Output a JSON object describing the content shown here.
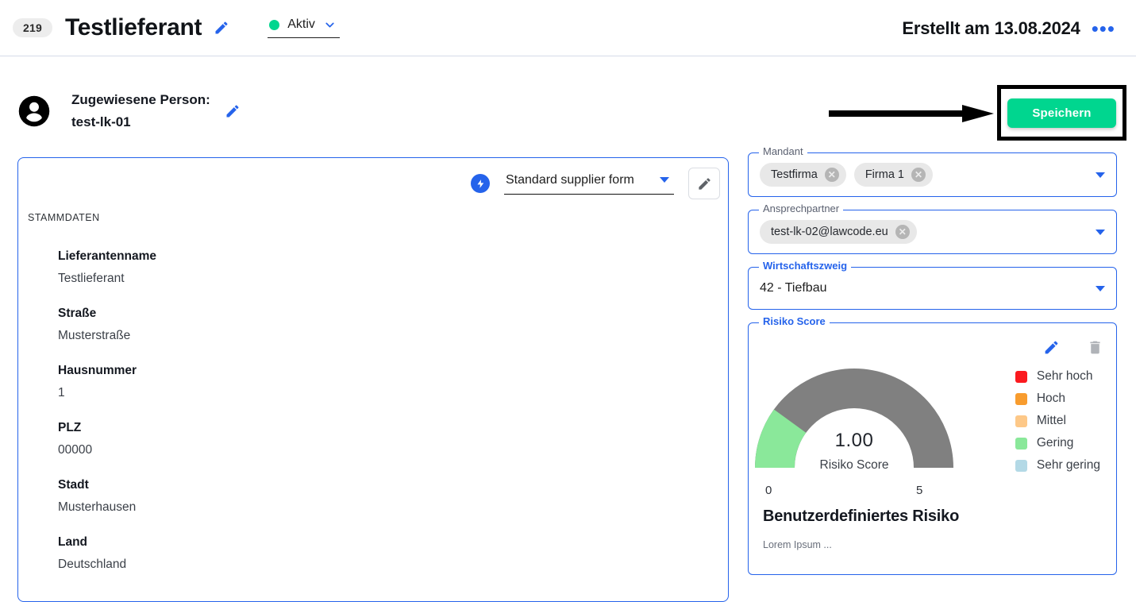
{
  "header": {
    "id_badge": "219",
    "title": "Testlieferant",
    "edit_icon": "pencil-icon",
    "status": {
      "label": "Aktiv",
      "dot_color": "#00d68f",
      "chevron_icon": "chevron-down-icon"
    },
    "created_text": "Erstellt am 13.08.2024",
    "more_menu": "•••"
  },
  "person": {
    "avatar_icon": "account-circle-icon",
    "label": "Zugewiesene Person:",
    "name": "test-lk-01",
    "edit_icon": "pencil-icon"
  },
  "save": {
    "label": "Speichern",
    "color": "#00d68f",
    "annotation_arrow": "arrow-right-annotation",
    "highlight_box": "black-highlight-box"
  },
  "form_card": {
    "bolt_icon": "lightning-bolt-icon",
    "form_select_value": "Standard supplier form",
    "edit_icon": "pencil-icon",
    "section_label": "STAMMDATEN",
    "fields": [
      {
        "label": "Lieferantenname",
        "value": "Testlieferant"
      },
      {
        "label": "Straße",
        "value": "Musterstraße"
      },
      {
        "label": "Hausnummer",
        "value": "1"
      },
      {
        "label": "PLZ",
        "value": "00000"
      },
      {
        "label": "Stadt",
        "value": "Musterhausen"
      },
      {
        "label": "Land",
        "value": "Deutschland"
      }
    ]
  },
  "side_panel": {
    "mandant": {
      "legend": "Mandant",
      "chips": [
        "Testfirma",
        "Firma 1"
      ],
      "dropdown_icon": "triangle-down-icon"
    },
    "ansprechpartner": {
      "legend": "Ansprechpartner",
      "chips": [
        "test-lk-02@lawcode.eu"
      ],
      "dropdown_icon": "triangle-down-icon"
    },
    "wirtschaftszweig": {
      "legend": "Wirtschaftszweig",
      "value": "42 - Tiefbau",
      "dropdown_icon": "triangle-down-icon"
    },
    "risiko": {
      "legend": "Risiko Score",
      "edit_icon": "pencil-icon",
      "delete_icon": "trash-icon",
      "custom_title": "Benutzerdefiniertes Risiko",
      "custom_note": "Lorem Ipsum ..."
    }
  },
  "chart_data": {
    "type": "gauge",
    "title": "Risiko Score",
    "value": 1.0,
    "value_label": "1.00",
    "min": 0,
    "max": 5,
    "min_label": "0",
    "max_label": "5",
    "filled_color": "#8ae89a",
    "track_color": "#808080",
    "legend_position": "right",
    "legend": [
      {
        "label": "Sehr hoch",
        "color": "#fb1a1f"
      },
      {
        "label": "Hoch",
        "color": "#f89c2e"
      },
      {
        "label": "Mittel",
        "color": "#fdc888"
      },
      {
        "label": "Gering",
        "color": "#8ae89a"
      },
      {
        "label": "Sehr gering",
        "color": "#b3d9e6"
      }
    ]
  }
}
